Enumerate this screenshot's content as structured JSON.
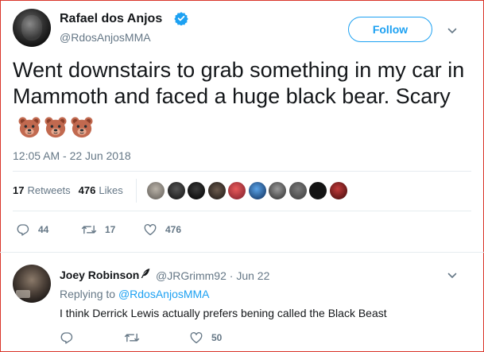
{
  "author": {
    "name": "Rafael dos Anjos",
    "handle": "@RdosAnjosMMA",
    "verified": true
  },
  "header": {
    "follow_label": "Follow"
  },
  "tweet": {
    "text": "Went downstairs to grab something in my car in Mammoth and faced a huge black bear. Scary",
    "emoji_count": 3,
    "timestamp": "12:05 AM - 22 Jun 2018"
  },
  "stats": {
    "retweets_count": "17",
    "retweets_label": "Retweets",
    "likes_count": "476",
    "likes_label": "Likes"
  },
  "actions": {
    "replies": "44",
    "retweets": "17",
    "likes": "476"
  },
  "reply": {
    "name": "Joey Robinson",
    "handle_date": "@JRGrimm92 · Jun 22",
    "replying_prefix": "Replying to",
    "replying_to": "@RdosAnjosMMA",
    "text": "I think Derrick Lewis actually prefers bening called the Black Beast",
    "actions": {
      "replies": "",
      "retweets": "",
      "likes": "50"
    }
  },
  "icons": {
    "verified": "verified-badge-icon",
    "caret": "chevron-down-icon",
    "reply": "reply-icon",
    "retweet": "retweet-icon",
    "like": "heart-icon",
    "feather": "feather-icon",
    "emoji": "bear-face-emoji"
  },
  "colors": {
    "accent": "#1da1f2",
    "muted": "#657786",
    "text": "#14171a",
    "border": "#d9362b",
    "divider": "#e6ecf0"
  }
}
